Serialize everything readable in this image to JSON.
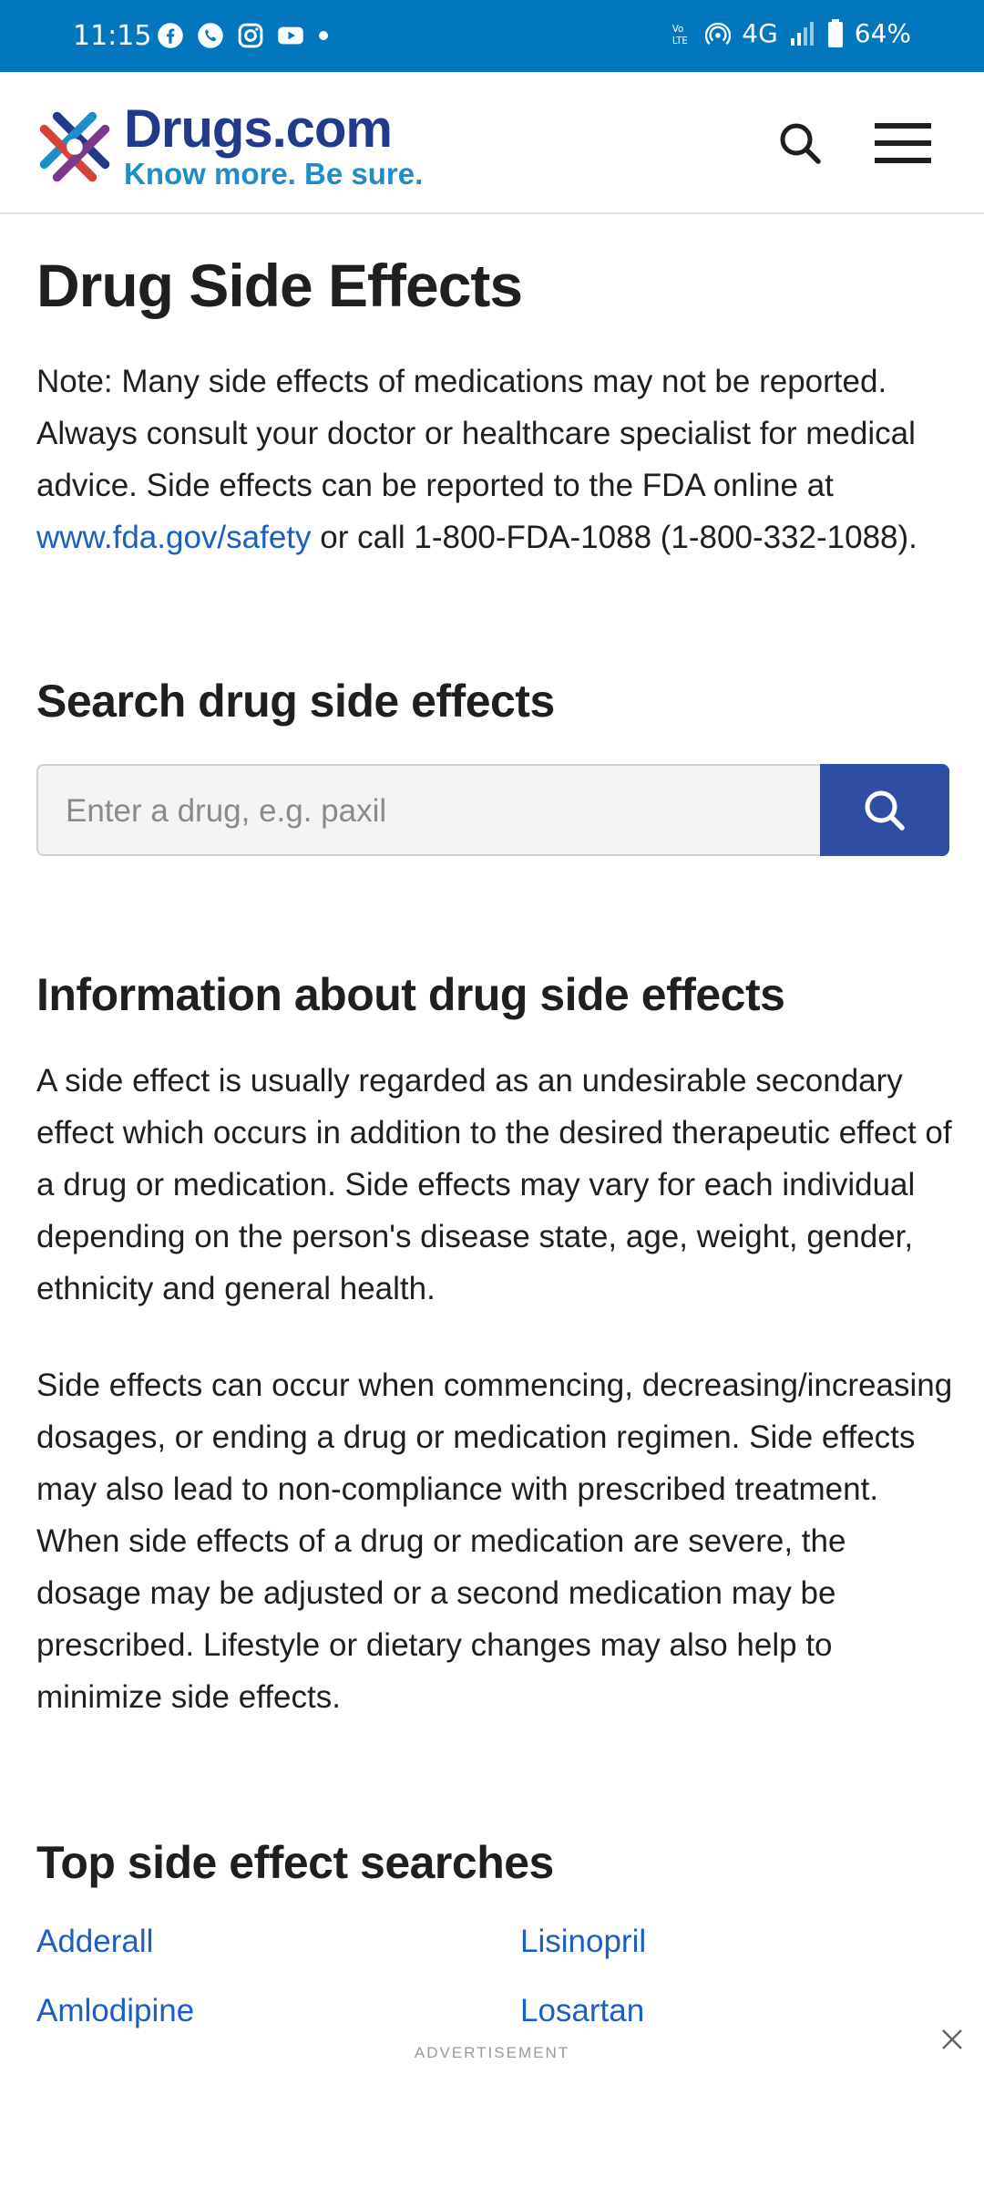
{
  "status_bar": {
    "time": "11:15",
    "battery": "64%",
    "network": "4G",
    "icons": [
      "facebook-icon",
      "phone-icon",
      "instagram-icon",
      "youtube-icon",
      "volte-icon",
      "hotspot-icon",
      "signal-icon",
      "battery-icon"
    ]
  },
  "header": {
    "brand_name": "Drugs.com",
    "brand_tagline": "Know more. Be sure.",
    "brand_colors": {
      "navy": "#233a8b",
      "blue": "#1f8dc7"
    }
  },
  "page": {
    "title": "Drug Side Effects",
    "note_text_1": "Note: Many side effects of medications may not be reported. Always consult your doctor or healthcare specialist for medical advice. Side effects can be reported to the FDA online at ",
    "note_link": "www.fda.gov/safety",
    "note_text_2": " or call 1-800-FDA-1088 (1-800-332-1088)."
  },
  "search": {
    "heading": "Search drug side effects",
    "placeholder": "Enter a drug, e.g. paxil",
    "value": "",
    "button_color": "#2e4ea3"
  },
  "info": {
    "heading": "Information about drug side effects",
    "paragraph_1": "A side effect is usually regarded as an undesirable secondary effect which occurs in addition to the desired therapeutic effect of a drug or medication. Side effects may vary for each individual depending on the person's disease state, age, weight, gender, ethnicity and general health.",
    "paragraph_2": "Side effects can occur when commencing, decreasing/increasing dosages, or ending a drug or medication regimen. Side effects may also lead to non-compliance with prescribed treatment. When side effects of a drug or medication are severe, the dosage may be adjusted or a second medication may be prescribed. Lifestyle or dietary changes may also help to minimize side effects."
  },
  "top_searches": {
    "heading": "Top side effect searches",
    "links": [
      "Adderall",
      "Lisinopril",
      "Amlodipine",
      "Losartan"
    ]
  },
  "ad": {
    "label": "ADVERTISEMENT"
  }
}
